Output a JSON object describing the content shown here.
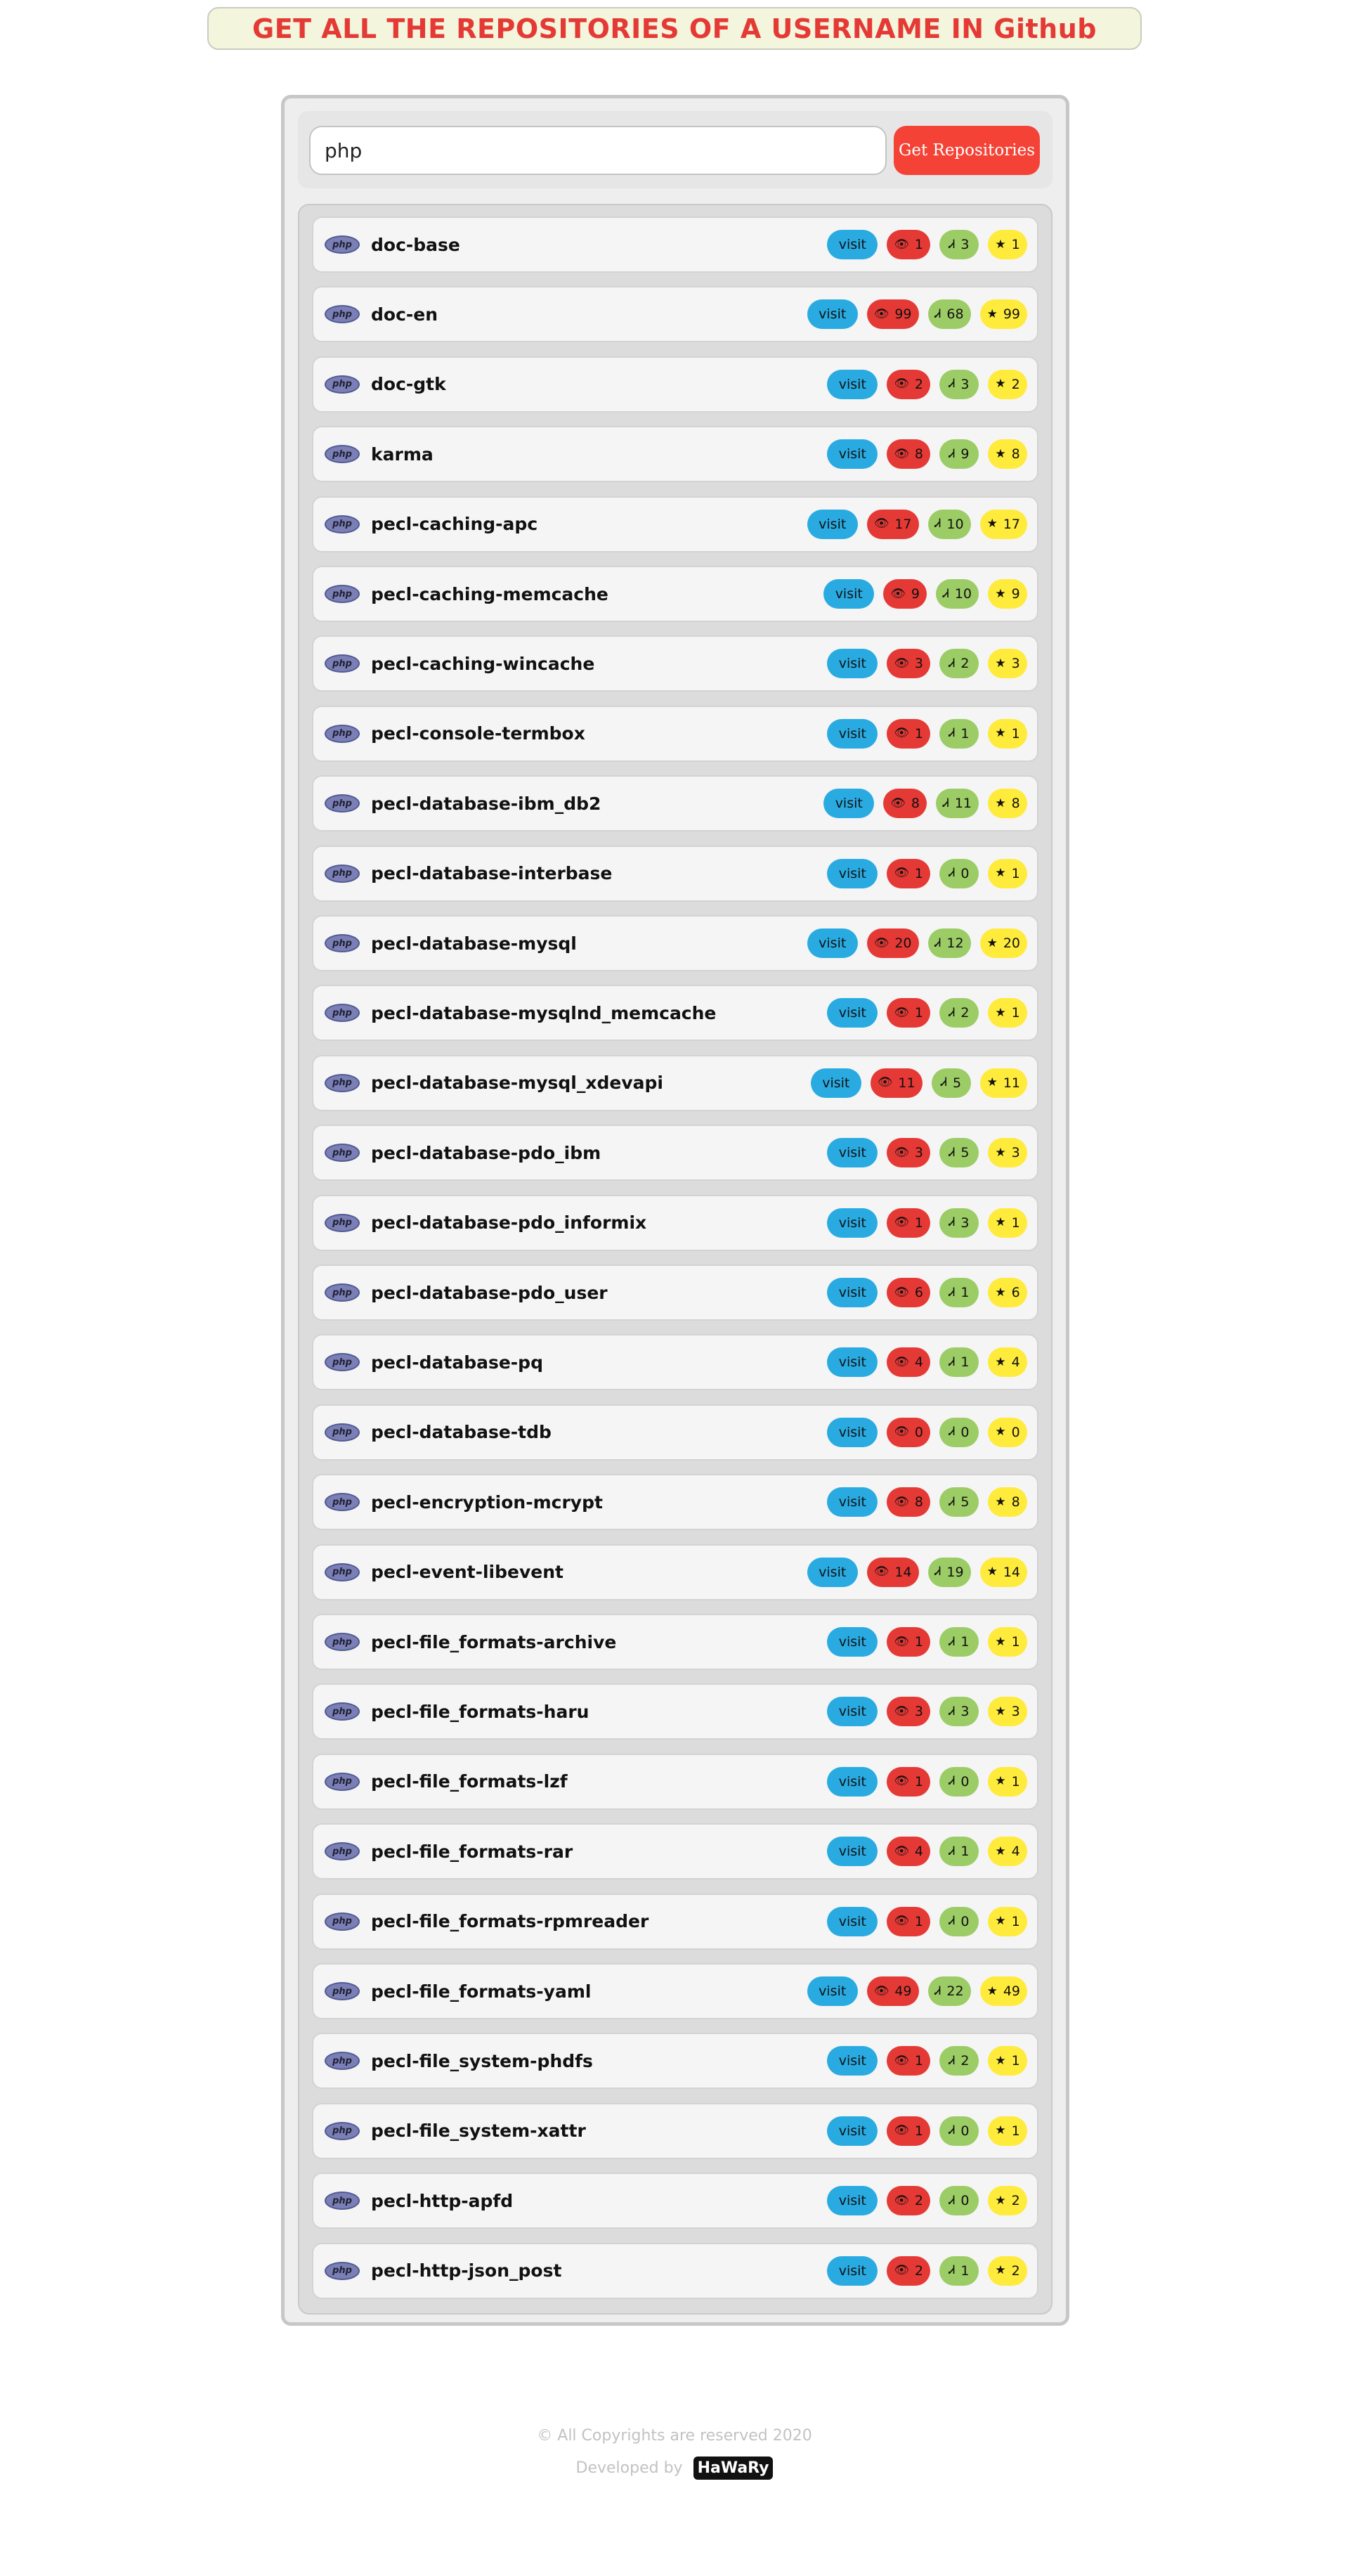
{
  "header": {
    "title": "GET ALL THE REPOSITORIES OF A USERNAME IN Github"
  },
  "search": {
    "value": "php",
    "button_label": "Get Repositories"
  },
  "repos": [
    {
      "name": "doc-base",
      "visit": "visit",
      "watchers": "1",
      "forks": "3",
      "stars": "1"
    },
    {
      "name": "doc-en",
      "visit": "visit",
      "watchers": "99",
      "forks": "68",
      "stars": "99"
    },
    {
      "name": "doc-gtk",
      "visit": "visit",
      "watchers": "2",
      "forks": "3",
      "stars": "2"
    },
    {
      "name": "karma",
      "visit": "visit",
      "watchers": "8",
      "forks": "9",
      "stars": "8"
    },
    {
      "name": "pecl-caching-apc",
      "visit": "visit",
      "watchers": "17",
      "forks": "10",
      "stars": "17"
    },
    {
      "name": "pecl-caching-memcache",
      "visit": "visit",
      "watchers": "9",
      "forks": "10",
      "stars": "9"
    },
    {
      "name": "pecl-caching-wincache",
      "visit": "visit",
      "watchers": "3",
      "forks": "2",
      "stars": "3"
    },
    {
      "name": "pecl-console-termbox",
      "visit": "visit",
      "watchers": "1",
      "forks": "1",
      "stars": "1"
    },
    {
      "name": "pecl-database-ibm_db2",
      "visit": "visit",
      "watchers": "8",
      "forks": "11",
      "stars": "8"
    },
    {
      "name": "pecl-database-interbase",
      "visit": "visit",
      "watchers": "1",
      "forks": "0",
      "stars": "1"
    },
    {
      "name": "pecl-database-mysql",
      "visit": "visit",
      "watchers": "20",
      "forks": "12",
      "stars": "20"
    },
    {
      "name": "pecl-database-mysqlnd_memcache",
      "visit": "visit",
      "watchers": "1",
      "forks": "2",
      "stars": "1"
    },
    {
      "name": "pecl-database-mysql_xdevapi",
      "visit": "visit",
      "watchers": "11",
      "forks": "5",
      "stars": "11"
    },
    {
      "name": "pecl-database-pdo_ibm",
      "visit": "visit",
      "watchers": "3",
      "forks": "5",
      "stars": "3"
    },
    {
      "name": "pecl-database-pdo_informix",
      "visit": "visit",
      "watchers": "1",
      "forks": "3",
      "stars": "1"
    },
    {
      "name": "pecl-database-pdo_user",
      "visit": "visit",
      "watchers": "6",
      "forks": "1",
      "stars": "6"
    },
    {
      "name": "pecl-database-pq",
      "visit": "visit",
      "watchers": "4",
      "forks": "1",
      "stars": "4"
    },
    {
      "name": "pecl-database-tdb",
      "visit": "visit",
      "watchers": "0",
      "forks": "0",
      "stars": "0"
    },
    {
      "name": "pecl-encryption-mcrypt",
      "visit": "visit",
      "watchers": "8",
      "forks": "5",
      "stars": "8"
    },
    {
      "name": "pecl-event-libevent",
      "visit": "visit",
      "watchers": "14",
      "forks": "19",
      "stars": "14"
    },
    {
      "name": "pecl-file_formats-archive",
      "visit": "visit",
      "watchers": "1",
      "forks": "1",
      "stars": "1"
    },
    {
      "name": "pecl-file_formats-haru",
      "visit": "visit",
      "watchers": "3",
      "forks": "3",
      "stars": "3"
    },
    {
      "name": "pecl-file_formats-lzf",
      "visit": "visit",
      "watchers": "1",
      "forks": "0",
      "stars": "1"
    },
    {
      "name": "pecl-file_formats-rar",
      "visit": "visit",
      "watchers": "4",
      "forks": "1",
      "stars": "4"
    },
    {
      "name": "pecl-file_formats-rpmreader",
      "visit": "visit",
      "watchers": "1",
      "forks": "0",
      "stars": "1"
    },
    {
      "name": "pecl-file_formats-yaml",
      "visit": "visit",
      "watchers": "49",
      "forks": "22",
      "stars": "49"
    },
    {
      "name": "pecl-file_system-phdfs",
      "visit": "visit",
      "watchers": "1",
      "forks": "2",
      "stars": "1"
    },
    {
      "name": "pecl-file_system-xattr",
      "visit": "visit",
      "watchers": "1",
      "forks": "0",
      "stars": "1"
    },
    {
      "name": "pecl-http-apfd",
      "visit": "visit",
      "watchers": "2",
      "forks": "0",
      "stars": "2"
    },
    {
      "name": "pecl-http-json_post",
      "visit": "visit",
      "watchers": "2",
      "forks": "1",
      "stars": "2"
    }
  ],
  "icons": {
    "language_logo": "php-logo-icon",
    "logo_text": "php",
    "watchers": "eye-icon",
    "forks": "fork-icon",
    "stars": "star-icon"
  },
  "colors": {
    "title": "#e53935",
    "visit": "#29abe2",
    "watchers": "#e53935",
    "forks": "#9ccc65",
    "stars": "#ffeb3b",
    "button": "#f44336"
  },
  "footer": {
    "copyright": "© All Copyrights are reserved 2020",
    "developed_by": "Developed by",
    "developer": "HaWaRy"
  }
}
